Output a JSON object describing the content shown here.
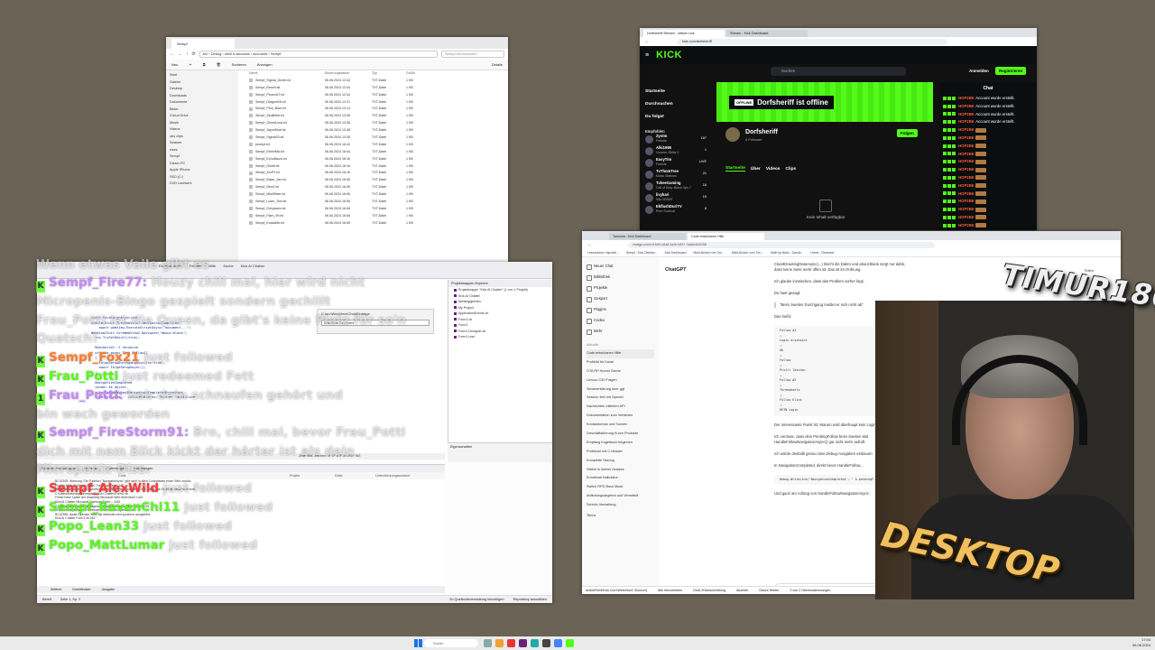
{
  "explorer": {
    "tab_title": "Sempf",
    "path": "bin › Debug › net8.0-windows › accounts › Sempf",
    "search_placeholder": "Sempf durchsuchen",
    "toolbar": [
      "Neu",
      "Sortieren",
      "Anzeigen",
      "Details"
    ],
    "nav": [
      "Start",
      "Galerie",
      "Desktop",
      "Downloads",
      "Dokumente",
      "Bilder",
      "iCloud Drive",
      "Musik",
      "Videos",
      "obs clips",
      "Stramer",
      "vices",
      "Sempf",
      "Dieser PC",
      "Apple iPhone",
      "SSD (C:)",
      "DVD Laufwerk"
    ],
    "columns": [
      "Name",
      "Änderungsdatum",
      "Typ",
      "Größe"
    ],
    "files": [
      [
        "Sempf_Sigma_Greek.txt",
        "06.06.2024 12:44",
        "TXT-Datei",
        "1 KB"
      ],
      [
        "Sempf_Brezel.txt",
        "06.06.2024 12:44",
        "TXT-Datei",
        "1 KB"
      ],
      [
        "Sempf_Phoenix7.txt",
        "06.06.2024 12:44",
        "TXT-Datei",
        "1 KB"
      ],
      [
        "Sempf_DragonKill.txt",
        "06.06.2024 12:21",
        "TXT-Datei",
        "1 KB"
      ],
      [
        "Sempf_Pfuh_Bam.txt",
        "06.06.2024 13:14",
        "TXT-Datei",
        "1 KB"
      ],
      [
        "Sempf_SkullMob.txt",
        "06.06.2024 13:38",
        "TXT-Datei",
        "1 KB"
      ],
      [
        "Sempf_GhostLuna.txt",
        "06.06.2024 13:38",
        "TXT-Datei",
        "1 KB"
      ],
      [
        "Sempf_JayceMob.txt",
        "06.06.2024 13:38",
        "TXT-Datei",
        "1 KB"
      ],
      [
        "Sempf_Sigma33.txt",
        "06.06.2024 13:36",
        "TXT-Datei",
        "1 KB"
      ],
      [
        "prompt.txt",
        "06.06.2024 16:44",
        "TXT-Datei",
        "1 KB"
      ],
      [
        "Sempf_EstrelMix.txt",
        "06.06.2024 16:44",
        "TXT-Datei",
        "1 KB"
      ],
      [
        "Sempf_EchoBaum.txt",
        "06.06.2024 16:16",
        "TXT-Datei",
        "1 KB"
      ],
      [
        "Sempf_Grisfit.txt",
        "06.06.2024 16:16",
        "TXT-Datei",
        "1 KB"
      ],
      [
        "Sempf_ArcP2.txt",
        "06.06.2024 16:16",
        "TXT-Datei",
        "1 KB"
      ],
      [
        "Sempf_Blaze_Jax.txt",
        "06.06.2024 16:06",
        "TXT-Datei",
        "1 KB"
      ],
      [
        "Sempf_NeoX.txt",
        "06.06.2024 16:06",
        "TXT-Datei",
        "1 KB"
      ],
      [
        "Sempf_MikeRider.txt",
        "06.06.2024 16:06",
        "TXT-Datei",
        "1 KB"
      ],
      [
        "Sempf_Loser_Tow.txt",
        "06.06.2024 16:06",
        "TXT-Datei",
        "1 KB"
      ],
      [
        "Sempf_Greydawn.txt",
        "06.06.2024 16:06",
        "TXT-Datei",
        "1 KB"
      ],
      [
        "Sempf_Flam_99.txt",
        "06.06.2024 16:06",
        "TXT-Datei",
        "1 KB"
      ],
      [
        "Sempf_KoalaMix.txt",
        "06.06.2024 16:06",
        "TXT-Datei",
        "1 KB"
      ]
    ]
  },
  "kick": {
    "tabs": [
      "Dorfsheriff Stream - Watch Live",
      "Stream - Kick Dashboard"
    ],
    "url": "kick.com/dorfsheriff",
    "logo": "KICK",
    "search_placeholder": "Suchen",
    "login": "Anmelden",
    "register": "Registrieren",
    "nav": [
      "Startseite",
      "Durchsuchen",
      "Du folgst"
    ],
    "recommended_label": "Empfohlen",
    "streamers": [
      {
        "name": "Zystm",
        "game": "Fortnite",
        "viewers": "167"
      },
      {
        "name": "Alki1995",
        "game": "Counter-Strike 2",
        "viewers": "1"
      },
      {
        "name": "EasyTim",
        "game": "Fortnite",
        "viewers": "LIVE"
      },
      {
        "name": "TvThomTree",
        "game": "Music Stations",
        "viewers": "21"
      },
      {
        "name": "TxkeeGaming",
        "game": "Call of Duty: Black Ops 7",
        "viewers": "16"
      },
      {
        "name": "livykari",
        "game": "VALORANT",
        "viewers": "19"
      },
      {
        "name": "EkflashDuriTV",
        "game": "Pure Survival",
        "viewers": "8"
      }
    ],
    "offline_tag": "OFFLINE",
    "offline_text": "Dorfsheriff ist offline",
    "channel_name": "Dorfsheriff",
    "followers": "0 Follower",
    "follow": "Folgen",
    "channel_tabs": [
      "Startseite",
      "Über",
      "Videos",
      "Clips"
    ],
    "no_content": "Kein Inhalt verfügbar",
    "chat_title": "Chat",
    "chat": [
      {
        "user": "HOP2B6",
        "text": "Account wurde erstellt."
      },
      {
        "user": "HOP2B6",
        "text": "Account wurde erstellt."
      },
      {
        "user": "HOP2B6",
        "text": "Account wurde erstellt."
      },
      {
        "user": "HOP2B6",
        "text": "Account wurde erstellt."
      },
      {
        "user": "HOP2B6",
        "text": ""
      },
      {
        "user": "HOP2B6",
        "text": ""
      },
      {
        "user": "HOP2B6",
        "text": ""
      },
      {
        "user": "HOP2B6",
        "text": ""
      },
      {
        "user": "HOP2B6",
        "text": ""
      },
      {
        "user": "HOP2B6",
        "text": ""
      },
      {
        "user": "HOP2B6",
        "text": ""
      },
      {
        "user": "HOP2B6",
        "text": ""
      },
      {
        "user": "HOP2B6",
        "text": ""
      },
      {
        "user": "HOP2B6",
        "text": ""
      },
      {
        "user": "HOP2B6",
        "text": ""
      },
      {
        "user": "HOP2B6",
        "text": ""
      },
      {
        "user": "HOP2B6",
        "text": ""
      },
      {
        "user": "HOP2B6",
        "text": ""
      },
      {
        "user": "HOP2B6",
        "text": ""
      }
    ]
  },
  "vs": {
    "menu": [
      "Erweiterungen",
      "Fenster",
      "Hilfe",
      "Suche",
      "Kick AI Chatter"
    ],
    "popup_title": "C:\\src\\WebView\\Chat\\Einträge",
    "popup_input": "Absuchen Dokument",
    "code_lines": [
      "await KickFolgeAsync(sb);",
      "WebView2Init.CoreWebView2.NavigationCompleted",
      "    await webView.ExecuteScriptAsync(\"document...\")",
      "WebView2Init.CoreWebView2.Navigate(\"about:blank\")",
      "  tcs.TrySetResult(true);",
      "",
      "  Bearbeitet: 2 Verweise",
      "  private async Task Follow()",
      "  {",
      "    FolgeSetupDurchgangAsync(ss:true);",
      "    await FolgeSetupAsync();",
      "  }",
      "",
      "  NavigationCompleted",
      "  sender As Object,",
      "  e As CoreWebView2NavigationCompletedEventArgs",
      "    Me.Activate  ' ActivateSource: Source: TaskInline"
    ],
    "solution_title": "Projektmappen-Explorer",
    "solution_items": [
      "Projektmappe \"Kick AI Chatter\" (1 von 1 Projekt)",
      "Kick AI Chatter",
      "Abhängigkeiten",
      "My Project",
      "ApplicationEvents.vb",
      "Form1.vb",
      "Form1",
      "Form1.Designer.vb",
      "Form1.resx"
    ],
    "properties_title": "Eigenschaften",
    "status_line": "Zeile: 894, Zeichen: 37   LF   UTF-8   CRLF   INS",
    "output_tabs": [
      "Gesamte Projektmappe",
      "20 Fehler",
      "0 Warnungen",
      "0 Meldungen"
    ],
    "output_columns": [
      "Code",
      "Projekt",
      "Datei",
      "Unterdrückungszustand"
    ],
    "output_lines": [
      "BC42105: Warnung: Die Funktion \"NavigateAsync\" gibt nicht in allen Codepfaden einen Wert zurück.",
      "Projekt: Kick AI Chatter  Datei: Form1.vb  Zeile: 243",
      "Möglicherweise tritt zur Laufzeit eine NullReference-Ausnahme auf, wenn das Ergebnis verwendet wird.",
      "C:\\Users\\timur\\source\\repos\\Kick AI Chatter\\Form1.vb",
      "Fehler beim Laden der Assembly Microsoft.Web.WebView2.Core",
      "Kick AI Chatter   Microsoft.Common.Curre...  2401",
      "C:\\Users\\timur\\.nuget\\packages\\microsoft.web.webview2\\1.0.2478.35",
      "In diesem asynchronen Methode fehlen Await-Operatoren.",
      "BC42356: Await-Operator fehlt; die Methode wird synchron ausgeführt.",
      "Kick AI Chatter   Form1.vb   263"
    ],
    "bottom_tabs": [
      "Weitere",
      "Direktfenster",
      "Ausgabe"
    ],
    "status": [
      "Bereit",
      "Zeile 1, Sp. 2",
      "Zu Quellcodeverwaltung hinzufügen",
      "Repository auswählen"
    ]
  },
  "gpt": {
    "tabs": [
      "Tarsuma - Kick Dashboard",
      "Code entschanen Hilfe"
    ],
    "url": "chatgpt.com/c/16cf0-a9a8-4a2b-b847-7ad6e4f40258",
    "bookmarks": [
      "Lesezeichen importie...",
      "Sempf - Kick Dashbo...",
      "Kick Dashboard",
      "Meld-Brüder von Ton...",
      "Meld-Brüder vom Ton...",
      "Multi by Mekk - Dashb...",
      "Home - Reviewer"
    ],
    "nav": [
      "Neuer Chat",
      "Bibliothek",
      "Projekte",
      "Gesport",
      "Plugins",
      "Codex",
      "Mehr"
    ],
    "recent_label": "Aktuelle",
    "conversations": [
      "Code entschanen Hilfe",
      "Profibild für Kanal",
      "GTA RP Humor Szene",
      "Lenovo C30 Fragen",
      "Steuererklärung über ggf",
      "Session fest mit OpenAI",
      "Nachrichten mittelem API",
      "Dokumentation zum Verfahren",
      "Kontaktschutz und Sonnen",
      "Geschäftsführung Kurze Produkte",
      "Empfang Kugelbuch beginnen",
      "Probleme mit C-Header",
      "Komplette Sitzung",
      "Switch in kleiner Analyse",
      "Emotional Kalkulator",
      "Switch RPG Boss Mode",
      "Abfindungsangebot und Vermittelt",
      "Schicht-Verwaltung"
    ],
    "user": "Timur",
    "model": "ChatGPT",
    "share": "Teilen",
    "messages": [
      "ClearBrowsingDataAsync(...) löscht die Daten und about:blank sorgt nur dafür, dass keine Seite mehr offen ist. Das ist im Ordnung.",
      "Ich glaube inzwischen, dass das Problem vorher liegt.",
      "Du hast gesagt:",
      "\"Beim zweiten Durchgang meldet er sich nicht ab\"",
      "Das heißt:"
    ],
    "code1": "Follow #1\n↓\nLogin erscheint\n↓\nOK\n↓\nFollow\n↓\nProfil löschen\n↓\nFollow #2\n↓\nThreewheels\n↓\nFollow klick\n↓\nKEIN Login",
    "messages2": [
      "Der interessante Punkt ist: Warum wird überhaupt kein Login geöffnet?",
      "Ich vermute, dass dein PendingFollow beim zweiten Mal HandleFollowNavigationAsync() gar nicht mehr aufruft.",
      "Ich würde deshalb genau zwei Debug-Ausgaben einbauen:",
      "In NavigationCompleted, direkt bevor HandleFollow..."
    ],
    "code2": "Debug.WriteLine(\"NavigationCompleted → \" & pendingF...)",
    "messages3": [
      "Und ganz am Anfang von HandleFollowNavigationAsync:"
    ],
    "composer": "Stelle irgendeine Frage",
    "status": [
      "ArticleFeed\\Kick.Com\\WebView2 \\Source\\]",
      "Alle hervorheben",
      "Groß-/Kleinschreibung",
      "Akzente",
      "Ganze Wörter",
      "2 von 2 Übereinstimmungen"
    ]
  },
  "overlay": [
    {
      "pre": "",
      "user": "",
      "msg": "Wenn etwas Vaile gibt es"
    },
    {
      "pre": "K",
      "user": "Sempf_Fire77:",
      "color": "pur",
      "msg": " Houzy chill mal, hier wird nicht"
    },
    {
      "pre": "",
      "user": "",
      "msg": "Micropenis-Bingo gespielt sondern gechillt"
    },
    {
      "pre": "",
      "user": "",
      "msg": "Frau_Potti ist die Queen, da gibt's keine Platz für so'n"
    },
    {
      "pre": "",
      "user": "",
      "msg": "Quatsch!"
    },
    {
      "pre": "K",
      "user": "Sempf_Fox21",
      "color": "org",
      "msg": " just followed"
    },
    {
      "pre": "K",
      "user": "Frau_Potti",
      "color": "",
      "msg": " just redeemed  Fett"
    },
    {
      "pre": "1",
      "user": "Frau_Potti:",
      "color": "pur",
      "msg": " hab dein schnaufen gehört und"
    },
    {
      "pre": "",
      "user": "",
      "msg": "bin wach geworden"
    },
    {
      "pre": "K",
      "user": "Sempf_FireStorm91:",
      "color": "pur",
      "msg": " Bro, chill mal, bevor Frau_Potti"
    },
    {
      "pre": "",
      "user": "",
      "msg": "dich mit nem Blick kickt der härter ist als dein"
    },
    {
      "pre": "",
      "user": "",
      "msg": "Micropenix-Diss."
    },
    {
      "pre": "K",
      "user": "Sempf_AlexWild",
      "color": "red",
      "msg": " just followed"
    },
    {
      "pre": "K",
      "user": "Sempf_RavenChi11",
      "color": "",
      "msg": " just followed"
    },
    {
      "pre": "K",
      "user": "Popo_Lean33",
      "color": "",
      "msg": " just followed"
    },
    {
      "pre": "K",
      "user": "Popo_MattLumar",
      "color": "",
      "msg": " just followed"
    }
  ],
  "logos": {
    "timur": "TIMUR1804",
    "desktop": "DESKTOP"
  },
  "taskbar": {
    "search": "Suche",
    "time": "17:04",
    "date": "06.06.2024"
  }
}
